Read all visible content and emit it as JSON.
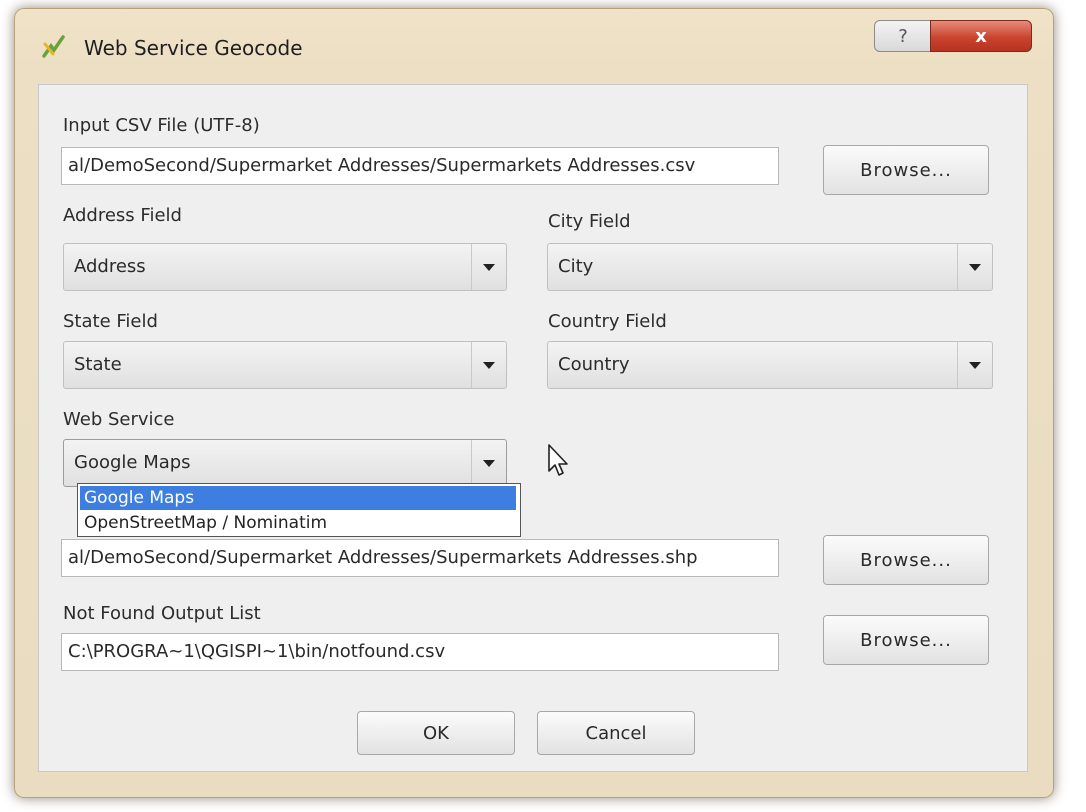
{
  "window": {
    "title": "Web Service Geocode",
    "help_glyph": "?",
    "close_glyph": "x",
    "icon": "qgis-icon"
  },
  "input_csv": {
    "label": "Input CSV File (UTF-8)",
    "value": "al/DemoSecond/Supermarket Addresses/Supermarkets Addresses.csv",
    "browse_label": "Browse..."
  },
  "address_field": {
    "label": "Address Field",
    "selected": "Address"
  },
  "city_field": {
    "label": "City Field",
    "selected": "City"
  },
  "state_field": {
    "label": "State Field",
    "selected": "State"
  },
  "country_field": {
    "label": "Country Field",
    "selected": "Country"
  },
  "web_service": {
    "label": "Web Service",
    "selected": "Google Maps",
    "options": [
      "Google Maps",
      "OpenStreetMap / Nominatim"
    ]
  },
  "output_shapefile": {
    "value": "al/DemoSecond/Supermarket Addresses/Supermarkets Addresses.shp",
    "browse_label": "Browse..."
  },
  "not_found": {
    "label": "Not Found Output List",
    "value": "C:\\PROGRA~1\\QGISPI~1\\bin/notfound.csv",
    "browse_label": "Browse..."
  },
  "footer": {
    "ok_label": "OK",
    "cancel_label": "Cancel"
  },
  "colors": {
    "frame": "#ecdfc3",
    "client": "#efefef",
    "selection": "#3d7ee0",
    "close": "#c94530"
  }
}
